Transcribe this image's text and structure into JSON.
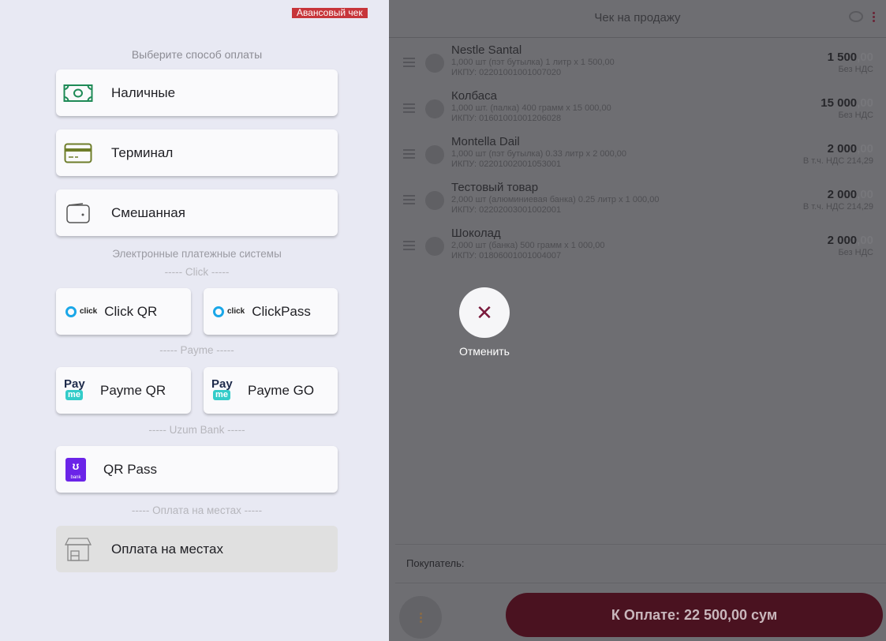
{
  "left_panel": {
    "advance_tag": "Авансовый чек",
    "choose_title": "Выберите способ оплаты",
    "methods": {
      "cash": "Наличные",
      "terminal": "Терминал",
      "mixed": "Смешанная"
    },
    "eps_title": "Электронные платежные системы",
    "click_section": "----- Click -----",
    "click_qr": "Click QR",
    "click_pass": "ClickPass",
    "click_logo": "click",
    "payme_section": "----- Payme -----",
    "payme_qr": "Payme QR",
    "payme_go": "Payme GO",
    "payme_logo_top": "Pay",
    "payme_logo_bottom": "me",
    "uzum_section": "----- Uzum Bank -----",
    "qr_pass": "QR Pass",
    "uzum_logo_text": "bank",
    "onsite_section": "----- Оплата на местах -----",
    "onsite": "Оплата на местах"
  },
  "right_panel": {
    "title": "Чек на продажу",
    "items": [
      {
        "name": "Nestle Santal",
        "desc": "1,000 шт (пэт бутылка) 1 литр x 1 500,00",
        "ikpu": "ИКПУ: 02201001001007020",
        "sum_int": "1 500",
        "sum_dec": ",00",
        "tax": "Без НДС"
      },
      {
        "name": "Колбаса",
        "desc": "1,000 шт. (палка) 400 грамм x 15 000,00",
        "ikpu": "ИКПУ: 01601001001206028",
        "sum_int": "15 000",
        "sum_dec": ",00",
        "tax": "Без НДС"
      },
      {
        "name": "Montella Dail",
        "desc": "1,000 шт (пэт бутылка) 0.33 литр x 2 000,00",
        "ikpu": "ИКПУ: 02201002001053001",
        "sum_int": "2 000",
        "sum_dec": ",00",
        "tax": "В т.ч. НДС 214,29"
      },
      {
        "name": "Тестовый товар",
        "desc": "2,000 шт (алюминиевая банка) 0.25 литр x 1 000,00",
        "ikpu": "ИКПУ: 02202003001002001",
        "sum_int": "2 000",
        "sum_dec": ",00",
        "tax": "В т.ч. НДС 214,29"
      },
      {
        "name": "Шоколад",
        "desc": "2,000 шт (банка) 500 грамм x 1 000,00",
        "ikpu": "ИКПУ: 01806001001004007",
        "sum_int": "2 000",
        "sum_dec": ",00",
        "tax": "Без НДС"
      }
    ],
    "cancel_label": "Отменить",
    "cancel_icon": "close-icon",
    "buyer_label": "Покупатель:",
    "pay_button": "К Оплате: 22 500,00 сум"
  }
}
